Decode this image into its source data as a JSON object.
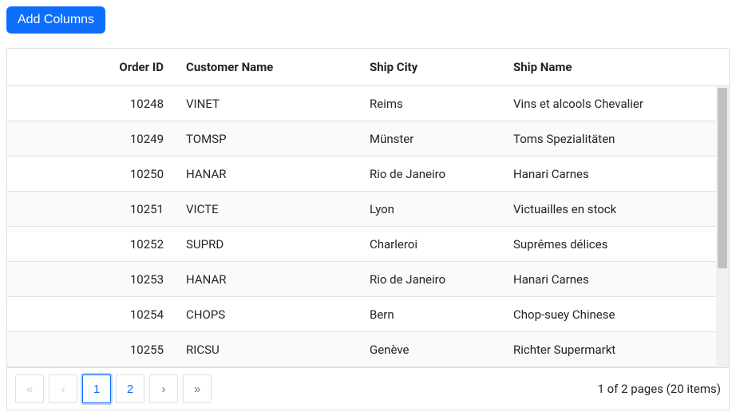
{
  "toolbar": {
    "add_columns_label": "Add Columns"
  },
  "grid": {
    "columns": {
      "order_id": "Order ID",
      "customer_name": "Customer Name",
      "ship_city": "Ship City",
      "ship_name": "Ship Name"
    },
    "rows": [
      {
        "order_id": "10248",
        "customer_name": "VINET",
        "ship_city": "Reims",
        "ship_name": "Vins et alcools Chevalier"
      },
      {
        "order_id": "10249",
        "customer_name": "TOMSP",
        "ship_city": "Münster",
        "ship_name": "Toms Spezialitäten"
      },
      {
        "order_id": "10250",
        "customer_name": "HANAR",
        "ship_city": "Rio de Janeiro",
        "ship_name": "Hanari Carnes"
      },
      {
        "order_id": "10251",
        "customer_name": "VICTE",
        "ship_city": "Lyon",
        "ship_name": "Victuailles en stock"
      },
      {
        "order_id": "10252",
        "customer_name": "SUPRD",
        "ship_city": "Charleroi",
        "ship_name": "Suprêmes délices"
      },
      {
        "order_id": "10253",
        "customer_name": "HANAR",
        "ship_city": "Rio de Janeiro",
        "ship_name": "Hanari Carnes"
      },
      {
        "order_id": "10254",
        "customer_name": "CHOPS",
        "ship_city": "Bern",
        "ship_name": "Chop-suey Chinese"
      },
      {
        "order_id": "10255",
        "customer_name": "RICSU",
        "ship_city": "Genève",
        "ship_name": "Richter Supermarkt"
      }
    ]
  },
  "pager": {
    "first_icon": "«",
    "prev_icon": "‹",
    "next_icon": "›",
    "last_icon": "»",
    "pages": [
      "1",
      "2"
    ],
    "current_page": "1",
    "info_text": "1 of 2 pages (20 items)"
  }
}
